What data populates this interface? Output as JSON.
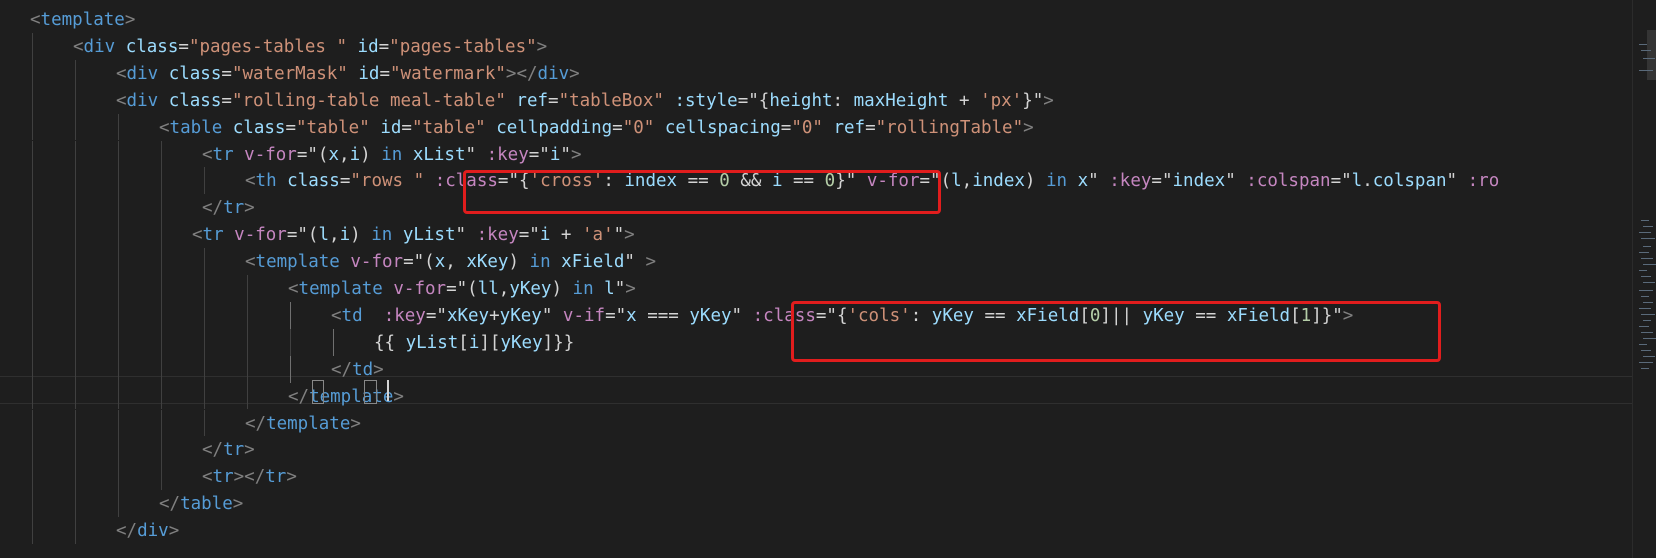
{
  "editor": {
    "language": "vue-html",
    "colors": {
      "background": "#1e1e1e",
      "tag": "#569cd6",
      "attribute": "#9cdcfe",
      "string": "#ce9178",
      "directive": "#c586c0",
      "highlight_border": "#e11d1d"
    },
    "cutoff_top_line": "<template>",
    "lines": [
      {
        "indent": 0,
        "tokens": [
          [
            "punc",
            "<"
          ],
          [
            "tag",
            "template"
          ],
          [
            "punc",
            ">"
          ]
        ]
      },
      {
        "indent": 1,
        "tokens": [
          [
            "punc",
            "<"
          ],
          [
            "tag",
            "div "
          ],
          [
            "attr",
            "class"
          ],
          [
            "op",
            "="
          ],
          [
            "str",
            "\"pages-tables \""
          ],
          [
            "txt",
            " "
          ],
          [
            "attr",
            "id"
          ],
          [
            "op",
            "="
          ],
          [
            "str",
            "\"pages-tables\""
          ],
          [
            "punc",
            ">"
          ]
        ]
      },
      {
        "indent": 2,
        "tokens": [
          [
            "punc",
            "<"
          ],
          [
            "tag",
            "div "
          ],
          [
            "attr",
            "class"
          ],
          [
            "op",
            "="
          ],
          [
            "str",
            "\"waterMask\""
          ],
          [
            "txt",
            " "
          ],
          [
            "attr",
            "id"
          ],
          [
            "op",
            "="
          ],
          [
            "str",
            "\"watermark\""
          ],
          [
            "punc",
            "></"
          ],
          [
            "tag",
            "div"
          ],
          [
            "punc",
            ">"
          ]
        ]
      },
      {
        "indent": 2,
        "tokens": [
          [
            "punc",
            "<"
          ],
          [
            "tag",
            "div "
          ],
          [
            "attr",
            "class"
          ],
          [
            "op",
            "="
          ],
          [
            "str",
            "\"rolling-table meal-table\""
          ],
          [
            "txt",
            " "
          ],
          [
            "attr",
            "ref"
          ],
          [
            "op",
            "="
          ],
          [
            "str",
            "\"tableBox\""
          ],
          [
            "txt",
            " "
          ],
          [
            "attr",
            ":style"
          ],
          [
            "op",
            "="
          ],
          [
            "txt",
            "\"{"
          ],
          [
            "var",
            "height"
          ],
          [
            "txt",
            ": "
          ],
          [
            "var",
            "maxHeight"
          ],
          [
            "txt",
            " + "
          ],
          [
            "str",
            "'px'"
          ],
          [
            "txt",
            "}\""
          ],
          [
            "punc",
            ">"
          ]
        ]
      },
      {
        "indent": 3,
        "tokens": [
          [
            "punc",
            "<"
          ],
          [
            "tag",
            "table "
          ],
          [
            "attr",
            "class"
          ],
          [
            "op",
            "="
          ],
          [
            "str",
            "\"table\""
          ],
          [
            "txt",
            " "
          ],
          [
            "attr",
            "id"
          ],
          [
            "op",
            "="
          ],
          [
            "str",
            "\"table\""
          ],
          [
            "txt",
            " "
          ],
          [
            "attr",
            "cellpadding"
          ],
          [
            "op",
            "="
          ],
          [
            "str",
            "\"0\""
          ],
          [
            "txt",
            " "
          ],
          [
            "attr",
            "cellspacing"
          ],
          [
            "op",
            "="
          ],
          [
            "str",
            "\"0\""
          ],
          [
            "txt",
            " "
          ],
          [
            "attr",
            "ref"
          ],
          [
            "op",
            "="
          ],
          [
            "str",
            "\"rollingTable\""
          ],
          [
            "punc",
            ">"
          ]
        ]
      },
      {
        "indent": 4,
        "tokens": [
          [
            "punc",
            "<"
          ],
          [
            "tag",
            "tr "
          ],
          [
            "dir",
            "v-for"
          ],
          [
            "op",
            "="
          ],
          [
            "txt",
            "\"("
          ],
          [
            "var",
            "x"
          ],
          [
            "txt",
            ","
          ],
          [
            "var",
            "i"
          ],
          [
            "txt",
            ") "
          ],
          [
            "tag",
            "in"
          ],
          [
            "txt",
            " "
          ],
          [
            "var",
            "xList"
          ],
          [
            "txt",
            "\""
          ],
          [
            "txt",
            " "
          ],
          [
            "dir",
            ":key"
          ],
          [
            "op",
            "="
          ],
          [
            "txt",
            "\""
          ],
          [
            "var",
            "i"
          ],
          [
            "txt",
            "\""
          ],
          [
            "punc",
            ">"
          ]
        ]
      },
      {
        "indent": 5,
        "tokens": [
          [
            "punc",
            "<"
          ],
          [
            "tag",
            "th "
          ],
          [
            "attr",
            "class"
          ],
          [
            "op",
            "="
          ],
          [
            "str",
            "\"rows \""
          ],
          [
            "txt",
            " "
          ],
          [
            "dir",
            ":class"
          ],
          [
            "op",
            "="
          ],
          [
            "txt",
            "\"{"
          ],
          [
            "str",
            "'cross'"
          ],
          [
            "txt",
            ": "
          ],
          [
            "var",
            "index"
          ],
          [
            "txt",
            " == "
          ],
          [
            "num",
            "0"
          ],
          [
            "txt",
            " && "
          ],
          [
            "var",
            "i"
          ],
          [
            "txt",
            " == "
          ],
          [
            "num",
            "0"
          ],
          [
            "txt",
            "}\""
          ],
          [
            "txt",
            " "
          ],
          [
            "dir",
            "v-for"
          ],
          [
            "op",
            "="
          ],
          [
            "txt",
            "\"("
          ],
          [
            "var",
            "l"
          ],
          [
            "txt",
            ","
          ],
          [
            "var",
            "index"
          ],
          [
            "txt",
            ") "
          ],
          [
            "tag",
            "in"
          ],
          [
            "txt",
            " "
          ],
          [
            "var",
            "x"
          ],
          [
            "txt",
            "\""
          ],
          [
            "txt",
            " "
          ],
          [
            "dir",
            ":key"
          ],
          [
            "op",
            "="
          ],
          [
            "txt",
            "\""
          ],
          [
            "var",
            "index"
          ],
          [
            "txt",
            "\""
          ],
          [
            "txt",
            " "
          ],
          [
            "dir",
            ":colspan"
          ],
          [
            "op",
            "="
          ],
          [
            "txt",
            "\""
          ],
          [
            "var",
            "l"
          ],
          [
            "txt",
            "."
          ],
          [
            "var",
            "colspan"
          ],
          [
            "txt",
            "\""
          ],
          [
            "txt",
            " "
          ],
          [
            "dir",
            ":ro"
          ]
        ]
      },
      {
        "indent": 4,
        "tokens": [
          [
            "punc",
            "</"
          ],
          [
            "tag",
            "tr"
          ],
          [
            "punc",
            ">"
          ]
        ]
      },
      {
        "indent": 4,
        "offset": -10,
        "tokens": [
          [
            "punc",
            "<"
          ],
          [
            "tag",
            "tr "
          ],
          [
            "dir",
            "v-for"
          ],
          [
            "op",
            "="
          ],
          [
            "txt",
            "\"("
          ],
          [
            "var",
            "l"
          ],
          [
            "txt",
            ","
          ],
          [
            "var",
            "i"
          ],
          [
            "txt",
            ") "
          ],
          [
            "tag",
            "in"
          ],
          [
            "txt",
            " "
          ],
          [
            "var",
            "yList"
          ],
          [
            "txt",
            "\""
          ],
          [
            "txt",
            " "
          ],
          [
            "dir",
            ":key"
          ],
          [
            "op",
            "="
          ],
          [
            "txt",
            "\""
          ],
          [
            "var",
            "i"
          ],
          [
            "txt",
            " + "
          ],
          [
            "str",
            "'a'"
          ],
          [
            "txt",
            "\""
          ],
          [
            "punc",
            ">"
          ]
        ]
      },
      {
        "indent": 5,
        "tokens": [
          [
            "punc",
            "<"
          ],
          [
            "tag",
            "template "
          ],
          [
            "dir",
            "v-for"
          ],
          [
            "op",
            "="
          ],
          [
            "txt",
            "\"("
          ],
          [
            "var",
            "x"
          ],
          [
            "txt",
            ", "
          ],
          [
            "var",
            "xKey"
          ],
          [
            "txt",
            ") "
          ],
          [
            "tag",
            "in"
          ],
          [
            "txt",
            " "
          ],
          [
            "var",
            "xField"
          ],
          [
            "txt",
            "\""
          ],
          [
            "txt",
            " "
          ],
          [
            "punc",
            ">"
          ]
        ]
      },
      {
        "indent": 6,
        "tokens": [
          [
            "punc",
            "<"
          ],
          [
            "tag",
            "template "
          ],
          [
            "dir",
            "v-for"
          ],
          [
            "op",
            "="
          ],
          [
            "txt",
            "\"("
          ],
          [
            "var",
            "ll"
          ],
          [
            "txt",
            ","
          ],
          [
            "var",
            "yKey"
          ],
          [
            "txt",
            ") "
          ],
          [
            "tag",
            "in"
          ],
          [
            "txt",
            " "
          ],
          [
            "var",
            "l"
          ],
          [
            "txt",
            "\""
          ],
          [
            "punc",
            ">"
          ]
        ]
      },
      {
        "indent": 7,
        "tokens": [
          [
            "punc",
            "<"
          ],
          [
            "tag",
            "td "
          ],
          [
            "txt",
            " "
          ],
          [
            "dir",
            ":key"
          ],
          [
            "op",
            "="
          ],
          [
            "txt",
            "\""
          ],
          [
            "var",
            "xKey"
          ],
          [
            "txt",
            "+"
          ],
          [
            "var",
            "yKey"
          ],
          [
            "txt",
            "\""
          ],
          [
            "txt",
            " "
          ],
          [
            "dir",
            "v-if"
          ],
          [
            "op",
            "="
          ],
          [
            "txt",
            "\""
          ],
          [
            "var",
            "x"
          ],
          [
            "txt",
            " === "
          ],
          [
            "var",
            "yKey"
          ],
          [
            "txt",
            "\""
          ],
          [
            "txt",
            " "
          ],
          [
            "dir",
            ":class"
          ],
          [
            "op",
            "="
          ],
          [
            "txt",
            "\"{"
          ],
          [
            "str",
            "'cols'"
          ],
          [
            "txt",
            ": "
          ],
          [
            "var",
            "yKey"
          ],
          [
            "txt",
            " == "
          ],
          [
            "var",
            "xField"
          ],
          [
            "txt",
            "["
          ],
          [
            "num",
            "0"
          ],
          [
            "txt",
            "]|| "
          ],
          [
            "var",
            "yKey"
          ],
          [
            "txt",
            " == "
          ],
          [
            "var",
            "xField"
          ],
          [
            "txt",
            "["
          ],
          [
            "num",
            "1"
          ],
          [
            "txt",
            "]}\""
          ],
          [
            "punc",
            ">"
          ]
        ]
      },
      {
        "indent": 8,
        "tokens": [
          [
            "txt",
            "{{ "
          ],
          [
            "var",
            "yList"
          ],
          [
            "txt",
            "["
          ],
          [
            "var",
            "i"
          ],
          [
            "txt",
            "]["
          ],
          [
            "var",
            "yKey"
          ],
          [
            "txt",
            "]}}"
          ]
        ]
      },
      {
        "indent": 7,
        "tokens": [
          [
            "punc",
            "</"
          ],
          [
            "tag",
            "td"
          ],
          [
            "punc",
            ">"
          ]
        ]
      },
      {
        "indent": 6,
        "tokens": [
          [
            "punc",
            "</"
          ],
          [
            "tag",
            "template"
          ],
          [
            "punc",
            ">"
          ]
        ]
      },
      {
        "indent": 5,
        "tokens": [
          [
            "punc",
            "</"
          ],
          [
            "tag",
            "template"
          ],
          [
            "punc",
            ">"
          ]
        ]
      },
      {
        "indent": 4,
        "tokens": [
          [
            "punc",
            "</"
          ],
          [
            "tag",
            "tr"
          ],
          [
            "punc",
            ">"
          ]
        ]
      },
      {
        "indent": 4,
        "tokens": [
          [
            "punc",
            "<"
          ],
          [
            "tag",
            "tr"
          ],
          [
            "punc",
            "></"
          ],
          [
            "tag",
            "tr"
          ],
          [
            "punc",
            ">"
          ]
        ]
      },
      {
        "indent": 3,
        "tokens": [
          [
            "punc",
            "</"
          ],
          [
            "tag",
            "table"
          ],
          [
            "punc",
            ">"
          ]
        ]
      },
      {
        "indent": 2,
        "tokens": [
          [
            "punc",
            "</"
          ],
          [
            "tag",
            "div"
          ],
          [
            "punc",
            ">"
          ]
        ]
      }
    ],
    "highlighted_regions": [
      {
        "label": "cross-class-binding",
        "text": ":class=\"{'cross': index == 0 && i == 0}\""
      },
      {
        "label": "cols-class-binding",
        "text": ":class=\"{'cols': yKey == xField[0]|| yKey == xField[1]}\""
      }
    ]
  }
}
